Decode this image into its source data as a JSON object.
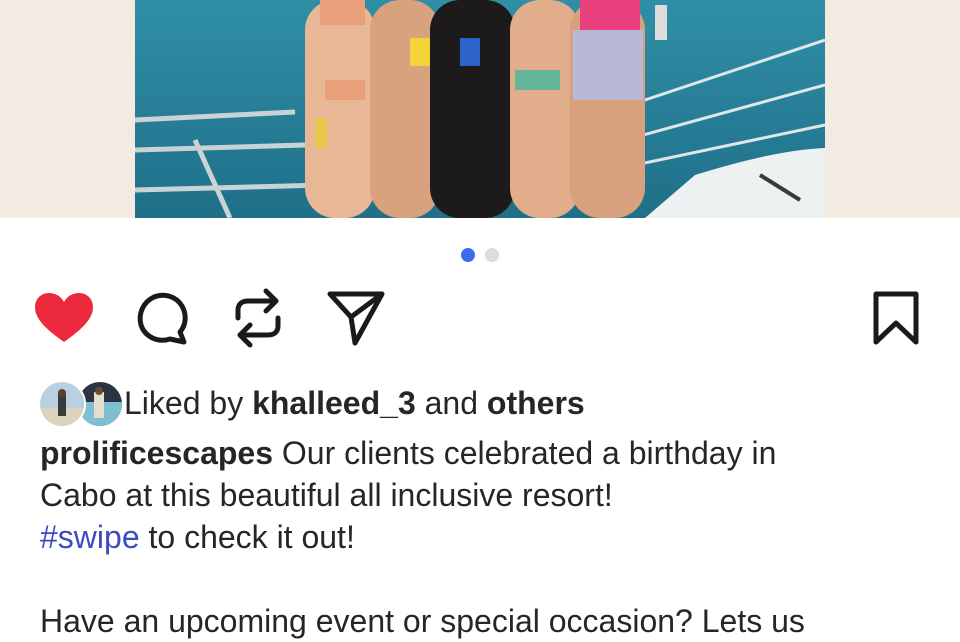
{
  "post": {
    "media": {
      "carousel_count": 2,
      "active_index": 0
    },
    "actions": {
      "like": "heart-icon",
      "comment": "comment-icon",
      "repost": "repost-icon",
      "share": "send-icon",
      "save": "bookmark-icon",
      "liked": true
    },
    "likes": {
      "prefix": "Liked by",
      "user": "khalleed_3",
      "conjunction": "and",
      "others": "others"
    },
    "caption": {
      "username": "prolificescapes",
      "line1": "Our clients celebrated a birthday in",
      "line2": "Cabo at this beautiful all inclusive resort!",
      "hashtag": "#swipe",
      "line3_rest": "to check it out!",
      "line4": "Have an upcoming event or special occasion? Lets us"
    }
  },
  "colors": {
    "heart": "#ed2a3d",
    "hashtag": "#3b4cc0",
    "dot_active": "#3e6cf1",
    "dot_inactive": "#d9dce1"
  }
}
